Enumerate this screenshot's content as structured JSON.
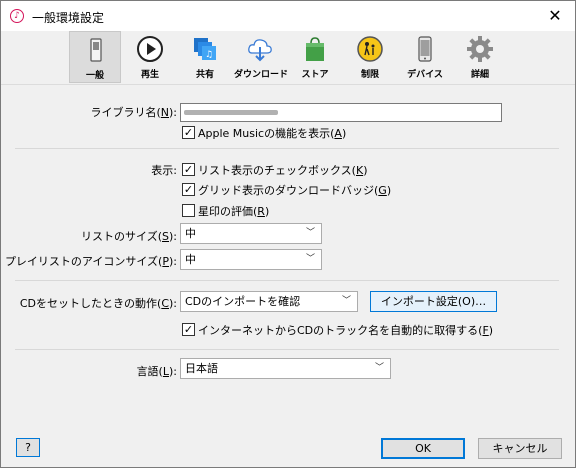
{
  "window": {
    "title": "一般環境設定",
    "close_label": "✕"
  },
  "toolbar": {
    "tabs": [
      {
        "label": "一般",
        "icon": "switch-icon",
        "active": true
      },
      {
        "label": "再生",
        "icon": "play-icon",
        "active": false
      },
      {
        "label": "共有",
        "icon": "sharing-icon",
        "active": false
      },
      {
        "label": "ダウンロード",
        "icon": "download-cloud-icon",
        "active": false
      },
      {
        "label": "ストア",
        "icon": "store-bag-icon",
        "active": false
      },
      {
        "label": "制限",
        "icon": "parental-control-icon",
        "active": false
      },
      {
        "label": "デバイス",
        "icon": "device-icon",
        "active": false
      },
      {
        "label": "詳細",
        "icon": "gear-icon",
        "active": false
      }
    ]
  },
  "library": {
    "label_text": "ライブラリ名(",
    "label_key": "N",
    "label_end": "):",
    "apple_music_prefix": "Apple Musicの機能を表示(",
    "apple_music_key": "A",
    "apple_music_end": ")",
    "apple_music_checked": true
  },
  "display": {
    "label": "表示:",
    "items": [
      {
        "prefix": "リスト表示のチェックボックス(",
        "key": "K",
        "end": ")",
        "checked": true
      },
      {
        "prefix": "グリッド表示のダウンロードバッジ(",
        "key": "G",
        "end": ")",
        "checked": true
      },
      {
        "prefix": "星印の評価(",
        "key": "R",
        "end": ")",
        "checked": false
      }
    ],
    "list_size": {
      "prefix": "リストのサイズ(",
      "key": "S",
      "end": "):",
      "value": "中"
    },
    "playlist_icon_size": {
      "prefix": "プレイリストのアイコンサイズ(",
      "key": "P",
      "end": "):",
      "value": "中"
    }
  },
  "cd": {
    "label_prefix": "CDをセットしたときの動作(",
    "label_key": "C",
    "label_end": "):",
    "value": "CDのインポートを確認",
    "import_button": "インポート設定(O)…",
    "track_names_prefix": "インターネットからCDのトラック名を自動的に取得する(",
    "track_names_key": "F",
    "track_names_end": ")",
    "track_names_checked": true
  },
  "language": {
    "prefix": "言語(",
    "key": "L",
    "end": "):",
    "value": "日本語"
  },
  "footer": {
    "help": "?",
    "ok": "OK",
    "cancel": "キャンセル"
  },
  "colors": {
    "accent": "#0078d7",
    "tab_active_bg": "#dcdcdc"
  }
}
